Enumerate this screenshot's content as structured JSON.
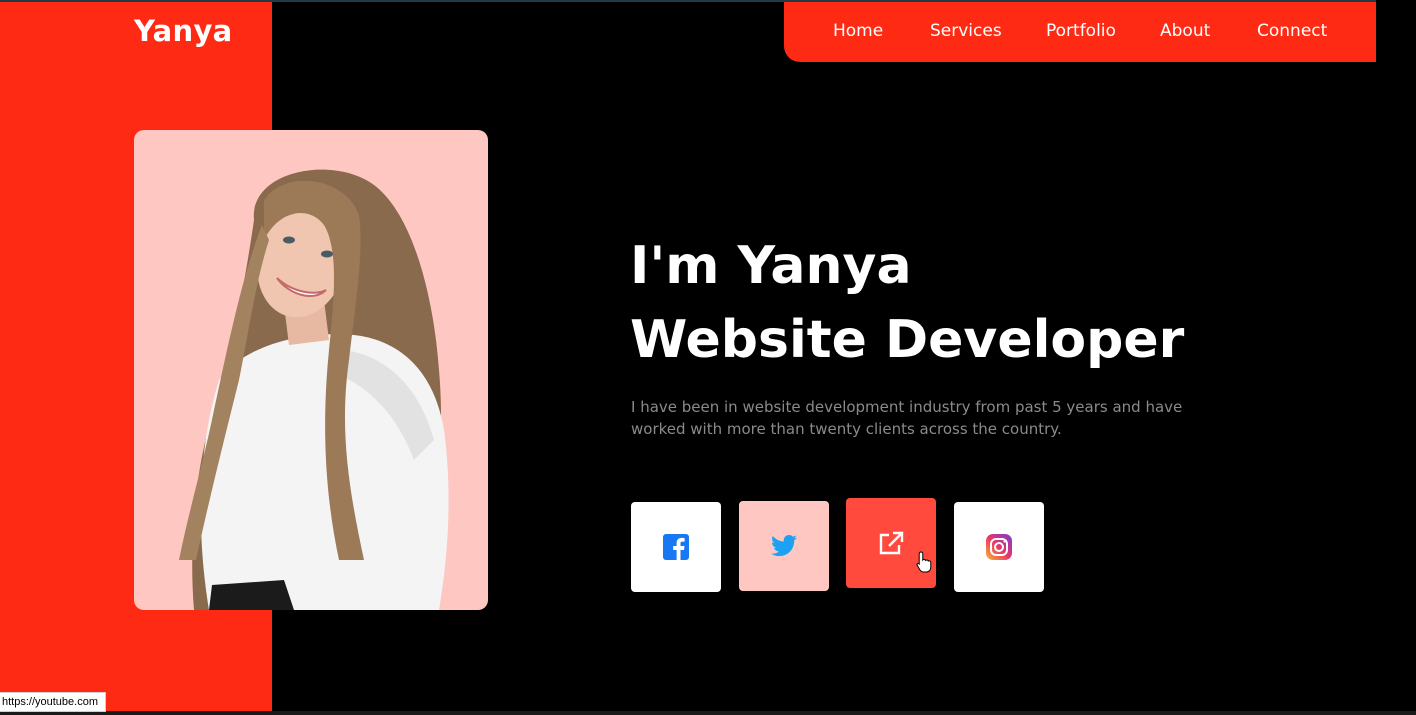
{
  "brand": {
    "name": "Yanya"
  },
  "nav": {
    "items": [
      {
        "label": "Home"
      },
      {
        "label": "Services"
      },
      {
        "label": "Portfolio"
      },
      {
        "label": "About"
      },
      {
        "label": "Connect"
      }
    ]
  },
  "hero": {
    "title_line1": "I'm Yanya",
    "title_line2": "Website Developer",
    "description": "I have been in website development industry from past 5 years and have worked with more than twenty clients across the country."
  },
  "social": [
    {
      "icon": "facebook-icon"
    },
    {
      "icon": "twitter-icon"
    },
    {
      "icon": "external-link-icon"
    },
    {
      "icon": "instagram-icon"
    }
  ],
  "status_bar": {
    "url": "https://youtube.com"
  },
  "colors": {
    "accent_red": "#ff2a14",
    "photo_bg": "#ffc7c2",
    "twitter_tile": "#ffc7c2",
    "link_tile": "#ff4a3d",
    "facebook_blue": "#1877f2",
    "twitter_blue": "#1da1f2"
  }
}
